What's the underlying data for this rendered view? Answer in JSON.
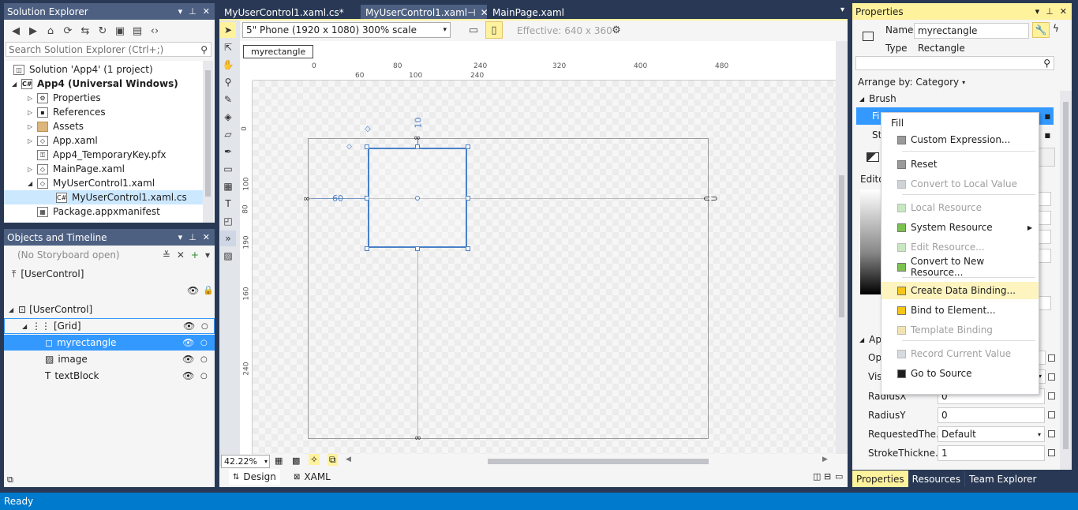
{
  "solution_explorer": {
    "title": "Solution Explorer",
    "search_placeholder": "Search Solution Explorer (Ctrl+;)",
    "items": [
      {
        "label": "Solution 'App4' (1 project)"
      },
      {
        "label": "App4 (Universal Windows)"
      },
      {
        "label": "Properties"
      },
      {
        "label": "References"
      },
      {
        "label": "Assets"
      },
      {
        "label": "App.xaml"
      },
      {
        "label": "App4_TemporaryKey.pfx"
      },
      {
        "label": "MainPage.xaml"
      },
      {
        "label": "MyUserControl1.xaml"
      },
      {
        "label": "MyUserControl1.xaml.cs"
      },
      {
        "label": "Package.appxmanifest"
      }
    ]
  },
  "objects_timeline": {
    "title": "Objects and Timeline",
    "storyboard": "(No Storyboard open)",
    "root": "[UserControl]",
    "tree": [
      {
        "label": "[UserControl]"
      },
      {
        "label": "[Grid]"
      },
      {
        "label": "myrectangle"
      },
      {
        "label": "image"
      },
      {
        "label": "textBlock"
      }
    ]
  },
  "doc_tabs": [
    {
      "label": "MyUserControl1.xaml.cs*"
    },
    {
      "label": "MyUserControl1.xaml"
    },
    {
      "label": "MainPage.xaml"
    }
  ],
  "designer": {
    "device": "5\" Phone (1920 x 1080) 300% scale",
    "effective": "Effective: 640 x 360",
    "element_label": "myrectangle",
    "zoom": "42.22%",
    "ruler_top": [
      "0",
      "60",
      "80",
      "100",
      "240",
      "240",
      "320",
      "400",
      "480"
    ],
    "ruler_left": [
      "0",
      "100",
      "80",
      "190",
      "160",
      "240"
    ],
    "margin_top": "10",
    "margin_left": "60",
    "design_tab": "Design",
    "xaml_tab": "XAML"
  },
  "properties": {
    "title": "Properties",
    "name_label": "Name",
    "name_value": "myrectangle",
    "type_label": "Type",
    "type_value": "Rectangle",
    "arrange_by": "Arrange by: Category",
    "brush_section": "Brush",
    "fill_label_partial": "Fi",
    "stroke_label_partial": "St",
    "editor_partial": "Edito",
    "appearance_partial": "Ap",
    "opacity_partial": "Op",
    "visibility_partial": "Vis",
    "rows": [
      {
        "label": "RadiusX",
        "value": "0"
      },
      {
        "label": "RadiusY",
        "value": "0"
      },
      {
        "label": "RequestedThe...",
        "value": "Default"
      },
      {
        "label": "StrokeThickne...",
        "value": "1"
      }
    ],
    "bottom_tabs": [
      "Properties",
      "Resources",
      "Team Explorer"
    ]
  },
  "context_menu": {
    "header": "Fill",
    "items": [
      {
        "label": "Custom Expression...",
        "color": "#9a9a9a",
        "disabled": false
      },
      {
        "label": "Reset",
        "color": "#9a9a9a",
        "disabled": false
      },
      {
        "label": "Convert to Local Value",
        "color": "#cfd3d8",
        "disabled": true
      },
      {
        "label": "Local Resource",
        "color": "#c8e6c0",
        "disabled": true
      },
      {
        "label": "System Resource",
        "color": "#7cc24f",
        "disabled": false
      },
      {
        "label": "Edit Resource...",
        "color": "#c8e6c0",
        "disabled": true
      },
      {
        "label": "Convert to New Resource...",
        "color": "#7cc24f",
        "disabled": false
      },
      {
        "label": "Create Data Binding...",
        "color": "#f5c518",
        "disabled": false
      },
      {
        "label": "Bind to Element...",
        "color": "#f5c518",
        "disabled": false
      },
      {
        "label": "Template Binding",
        "color": "#f2e3b3",
        "disabled": true
      },
      {
        "label": "Record Current Value",
        "color": "#d6dbe0",
        "disabled": true
      },
      {
        "label": "Go to Source",
        "color": "#1e1e1e",
        "disabled": false
      }
    ]
  },
  "status": {
    "text": "Ready"
  },
  "colors": {
    "accent": "#007acc",
    "selection": "#3399ff",
    "tab_active": "#fff29d"
  }
}
